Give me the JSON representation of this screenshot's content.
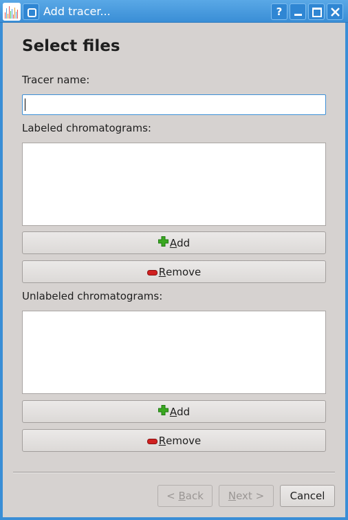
{
  "window": {
    "title": "Add tracer...",
    "help_glyph": "?",
    "icons": [
      "app-icon",
      "window-menu-icon",
      "help-icon",
      "minimize-icon",
      "maximize-icon",
      "close-icon"
    ]
  },
  "page": {
    "heading": "Select files",
    "tracer_name_label": "Tracer name:",
    "tracer_name_value": "",
    "labeled_label": "Labeled chromatograms:",
    "unlabeled_label": "Unlabeled chromatograms:"
  },
  "labeled_buttons": {
    "add_mnemonic": "A",
    "add_rest": "dd",
    "remove_mnemonic": "R",
    "remove_rest": "emove"
  },
  "unlabeled_buttons": {
    "add_mnemonic": "A",
    "add_rest": "dd",
    "remove_mnemonic": "R",
    "remove_rest": "emove"
  },
  "footer": {
    "back_prefix": "< ",
    "back_mnemonic": "B",
    "back_rest": "ack",
    "next_mnemonic": "N",
    "next_rest": "ext >",
    "cancel_label": "Cancel"
  },
  "colors": {
    "titlebar": "#3a8ed6",
    "dialog_bg": "#d6d2d0",
    "add_icon": "#3aa820",
    "remove_icon": "#d02020"
  }
}
